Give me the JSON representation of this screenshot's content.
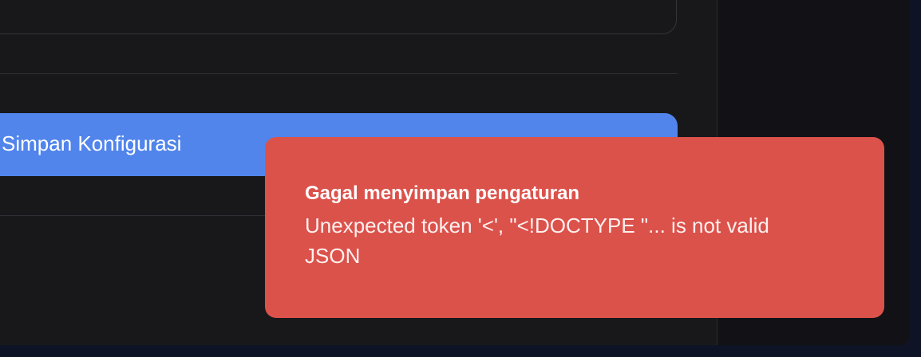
{
  "settings": {
    "save_button_label": "Simpan Konfigurasi"
  },
  "toast": {
    "title": "Gagal menyimpan pengaturan",
    "message": "Unexpected token '<', \"<!DOCTYPE \"... is not valid JSON",
    "background_color": "#db524b"
  },
  "colors": {
    "accent": "#5185ec",
    "panel": "#18181b",
    "error": "#db524b"
  }
}
